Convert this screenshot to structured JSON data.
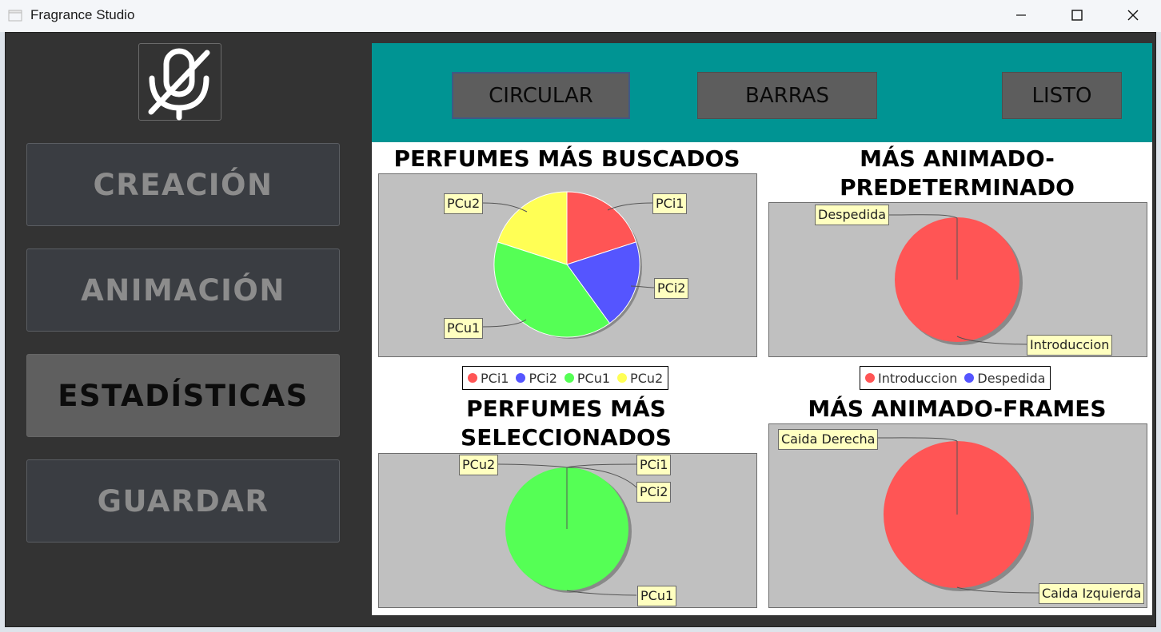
{
  "window": {
    "title": "Fragrance Studio"
  },
  "sidebar": {
    "logo": "mic-off-icon",
    "items": [
      {
        "label": "CREACIÓN",
        "active": false
      },
      {
        "label": "ANIMACIÓN",
        "active": false
      },
      {
        "label": "ESTADÍSTICAS",
        "active": true
      },
      {
        "label": "GUARDAR",
        "active": false
      }
    ]
  },
  "toolbar": {
    "circular": "CIRCULAR",
    "barras": "BARRAS",
    "listo": "LISTO"
  },
  "colors": {
    "accent": "#009493",
    "sidebar_bg": "#333333",
    "series_red": "#ff5555",
    "series_blue": "#5555ff",
    "series_green": "#55ff55",
    "series_yellow": "#ffff55"
  },
  "chart_data": [
    {
      "type": "pie",
      "title": "PERFUMES MÁS BUSCADOS",
      "categories": [
        "PCi1",
        "PCi2",
        "PCu1",
        "PCu2"
      ],
      "values": [
        2,
        2,
        4,
        2
      ],
      "colors": [
        "#ff5555",
        "#5555ff",
        "#55ff55",
        "#ffff55"
      ],
      "legend": "bottom"
    },
    {
      "type": "pie",
      "title": "MÁS ANIMADO-PREDETERMINADO",
      "categories": [
        "Introduccion",
        "Despedida"
      ],
      "values": [
        1,
        0
      ],
      "colors": [
        "#ff5555",
        "#5555ff"
      ],
      "legend": "bottom"
    },
    {
      "type": "pie",
      "title": "PERFUMES MÁS SELECCIONADOS",
      "categories": [
        "PCi1",
        "PCi2",
        "PCu1",
        "PCu2"
      ],
      "values": [
        0,
        0,
        1,
        0
      ],
      "colors": [
        "#ff5555",
        "#5555ff",
        "#55ff55",
        "#ffff55"
      ]
    },
    {
      "type": "pie",
      "title": "MÁS ANIMADO-FRAMES",
      "categories": [
        "Caida Izquierda",
        "Caida Derecha"
      ],
      "values": [
        1,
        0
      ],
      "colors": [
        "#ff5555",
        "#5555ff"
      ]
    }
  ]
}
